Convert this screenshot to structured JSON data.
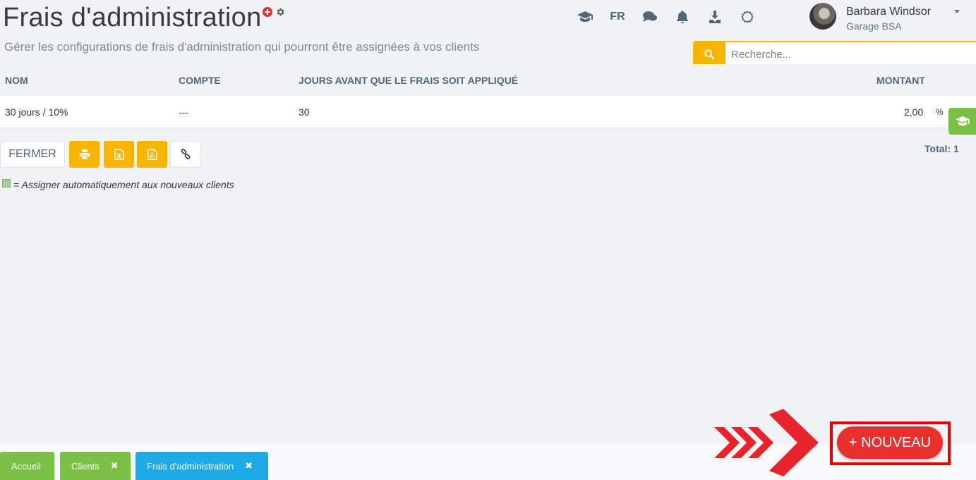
{
  "header": {
    "title": "Frais d'administration",
    "subtitle": "Gérer les configurations de frais d'administration qui pourront être assignées à vos clients"
  },
  "topbar": {
    "language": "FR",
    "user_name": "Barbara Windsor",
    "user_company": "Garage BSA"
  },
  "search": {
    "placeholder": "Recherche..."
  },
  "table": {
    "columns": [
      "NOM",
      "COMPTE",
      "JOURS AVANT QUE LE FRAIS SOIT APPLIQUÉ",
      "MONTANT"
    ],
    "rows": [
      {
        "nom": "30 jours / 10%",
        "compte": "---",
        "jours": "30",
        "montant": "2,00",
        "unit": "%"
      }
    ]
  },
  "toolbar": {
    "close_label": "FERMER",
    "total": "Total: 1"
  },
  "legend": {
    "text": "= Assigner automatiquement aux nouveaux clients"
  },
  "tabs": [
    {
      "label": "Accueil"
    },
    {
      "label": "Clients"
    },
    {
      "label": "Frais d'administration"
    }
  ],
  "new_button": {
    "label": "+ NOUVEAU"
  },
  "colors": {
    "accent_yellow": "#f7b500",
    "accent_green": "#7ac143",
    "accent_blue": "#1eaae7",
    "danger_red": "#e8312c"
  }
}
